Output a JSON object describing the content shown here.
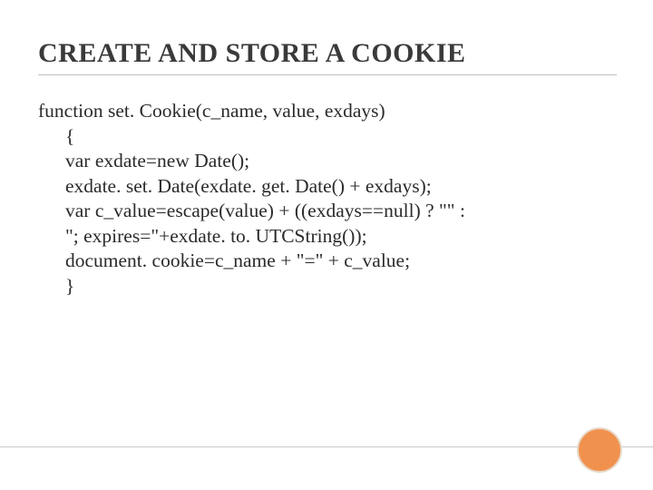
{
  "title": "CREATE AND STORE A COOKIE",
  "code": {
    "sig": "function set. Cookie(c_name, value, exdays)",
    "l1": "{",
    "l2": "var exdate=new Date();",
    "l3": "exdate. set. Date(exdate. get. Date() + exdays);",
    "l4": "var c_value=escape(value) + ((exdays==null) ? \"\" :",
    "l5": "\"; expires=\"+exdate. to. UTCString());",
    "l6": "document. cookie=c_name + \"=\" + c_value;",
    "l7": "}"
  }
}
